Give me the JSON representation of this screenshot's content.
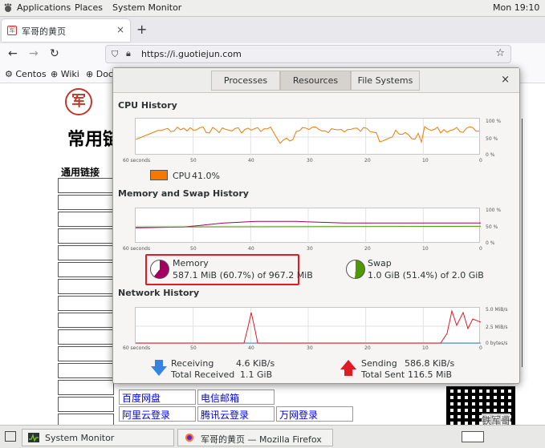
{
  "topbar": {
    "applications": "Applications",
    "places": "Places",
    "system_monitor": "System Monitor",
    "clock": "Mon 19:10"
  },
  "browser": {
    "tab_title": "军哥的黄页",
    "tab_close": "×",
    "new_tab": "+",
    "url": "https://i.guotiejun.com",
    "bookmarks": [
      "Centos",
      "Wiki",
      "Doc"
    ]
  },
  "page": {
    "heading": "常用链",
    "subheading": "通用链接",
    "links": [
      {
        "text": "百度网盘"
      },
      {
        "text": "电信邮箱"
      },
      {
        "text": "阿里云登录"
      },
      {
        "text": "腾讯云登录"
      },
      {
        "text": "万网登录"
      }
    ],
    "qr_caption": "铁军哥"
  },
  "sysmon": {
    "tabs": [
      "Processes",
      "Resources",
      "File Systems"
    ],
    "active_tab": "Resources",
    "close": "×",
    "cpu": {
      "title": "CPU History",
      "legend": "CPU",
      "value": "41.0%",
      "color": "#f57900",
      "y_ticks": [
        "100 %",
        "50 %",
        "0 %"
      ],
      "x_ticks": [
        "60 seconds",
        "50",
        "40",
        "30",
        "20",
        "10",
        "0"
      ]
    },
    "memory": {
      "title": "Memory and Swap History",
      "y_ticks": [
        "100 %",
        "50 %",
        "0 %"
      ],
      "x_ticks": [
        "60 seconds",
        "50",
        "40",
        "30",
        "20",
        "10",
        "0"
      ],
      "memory_label": "Memory",
      "memory_value": "587.1 MiB (60.7%) of 967.2 MiB",
      "memory_color": "#a40061",
      "memory_fraction": 0.607,
      "swap_label": "Swap",
      "swap_value": "1.0 GiB (51.4%) of 2.0 GiB",
      "swap_color": "#4e9a06",
      "swap_fraction": 0.514
    },
    "network": {
      "title": "Network History",
      "y_ticks": [
        "5.0 MiB/s",
        "2.5 MiB/s",
        "0 bytes/s"
      ],
      "x_ticks": [
        "60 seconds",
        "50",
        "40",
        "30",
        "20",
        "10",
        "0"
      ],
      "receiving_label": "Receiving",
      "receiving_rate": "4.6 KiB/s",
      "total_received_label": "Total Received",
      "total_received": "1.1 GiB",
      "sending_label": "Sending",
      "sending_rate": "586.8 KiB/s",
      "total_sent_label": "Total Sent",
      "total_sent": "116.5 MiB",
      "receive_color": "#3584e4",
      "send_color": "#e01b24"
    }
  },
  "taskbar": {
    "task1": "System Monitor",
    "task2": "军哥的黄页 — Mozilla Firefox"
  }
}
